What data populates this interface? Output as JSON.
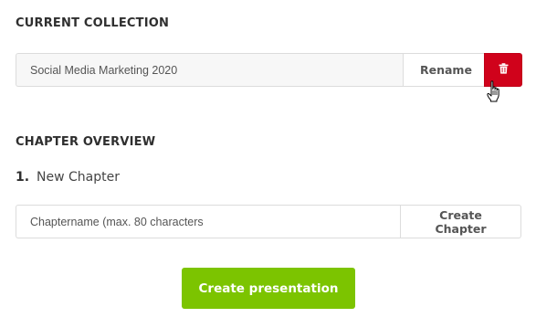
{
  "collection": {
    "heading": "CURRENT COLLECTION",
    "name_value": "Social Media Marketing 2020",
    "rename_label": "Rename",
    "delete_icon": "trash-icon",
    "delete_color": "#d0021b"
  },
  "chapters": {
    "heading": "CHAPTER OVERVIEW",
    "items": [
      {
        "number": "1.",
        "name": "New Chapter"
      }
    ],
    "input_placeholder": "Chaptername (max. 80 characters",
    "create_label": "Create Chapter"
  },
  "actions": {
    "create_presentation_label": "Create presentation",
    "primary_color": "#7cc400"
  },
  "cursor": "hand-pointer"
}
